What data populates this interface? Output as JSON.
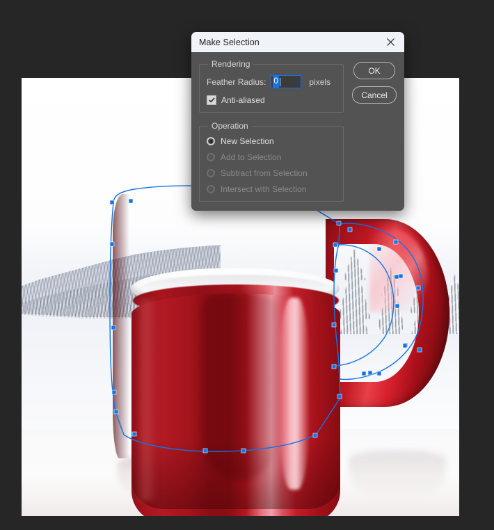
{
  "app": {
    "background_color": "#262626",
    "canvas": {
      "name": "mug-photograph",
      "description": "Red ceramic mug on reflective surface with snowy forest landscape background",
      "selection_path_color": "#1473e6"
    }
  },
  "dialog": {
    "title": "Make Selection",
    "close_icon": "close-icon",
    "rendering": {
      "legend": "Rendering",
      "feather_label": "Feather Radius:",
      "feather_value": "0",
      "feather_unit": "pixels",
      "antialiased_label": "Anti-aliased",
      "antialiased_checked": true
    },
    "operation": {
      "legend": "Operation",
      "options": [
        {
          "label": "New Selection",
          "selected": true,
          "disabled": false
        },
        {
          "label": "Add to Selection",
          "selected": false,
          "disabled": true
        },
        {
          "label": "Subtract from Selection",
          "selected": false,
          "disabled": true
        },
        {
          "label": "Intersect with Selection",
          "selected": false,
          "disabled": true
        }
      ]
    },
    "buttons": {
      "ok": "OK",
      "cancel": "Cancel"
    },
    "colors": {
      "titlebar_background": "#f0f3f7",
      "titlebar_text": "#1c1c1c",
      "body_background": "#535353",
      "group_border": "#6a6a6a",
      "text": "#e0e0e0",
      "disabled_text": "#8a8a8a",
      "focus_accent": "#1473e6"
    }
  }
}
